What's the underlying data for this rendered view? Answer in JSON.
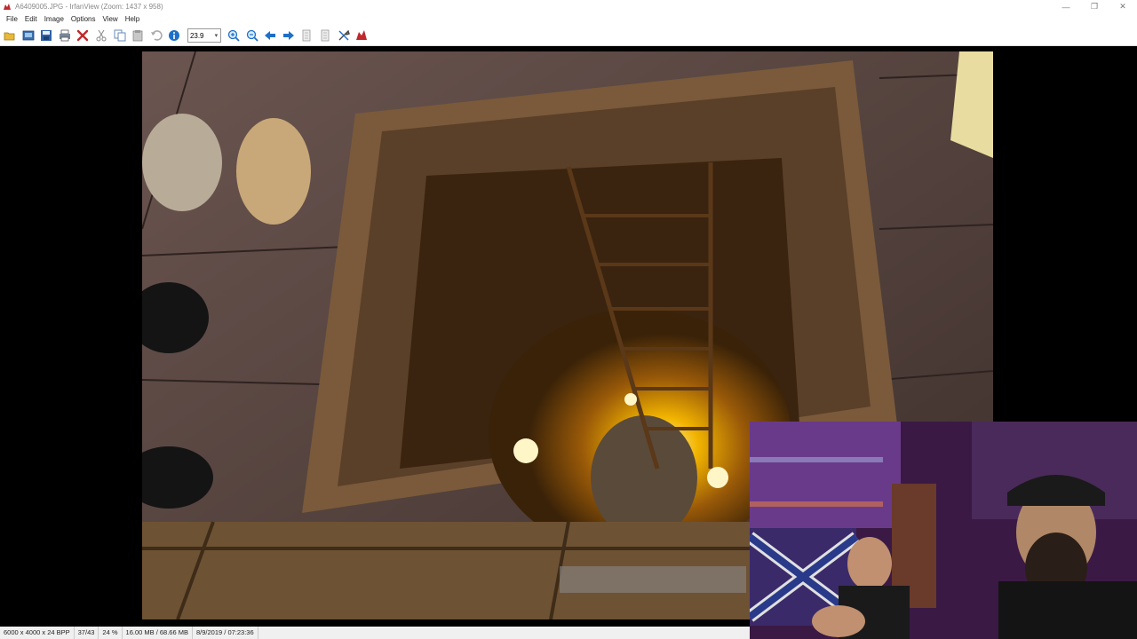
{
  "window": {
    "title": "A6409005.JPG - IrfanView (Zoom: 1437 x 958)",
    "minimize_glyph": "—",
    "maximize_glyph": "❐",
    "close_glyph": "✕"
  },
  "menu": {
    "items": [
      {
        "label": "File"
      },
      {
        "label": "Edit"
      },
      {
        "label": "Image"
      },
      {
        "label": "Options"
      },
      {
        "label": "View"
      },
      {
        "label": "Help"
      }
    ]
  },
  "toolbar": {
    "zoom_value": "23.9",
    "icons": [
      "open-folder-icon",
      "slideshow-icon",
      "save-icon",
      "print-icon",
      "delete-icon",
      "cut-icon",
      "copy-icon",
      "paste-icon",
      "undo-icon",
      "info-icon",
      "zoom-in-icon",
      "zoom-out-icon",
      "previous-icon",
      "next-icon",
      "first-page-icon",
      "last-page-icon",
      "properties-icon",
      "irfanview-logo-icon"
    ]
  },
  "status": {
    "dimensions": "6000 x 4000 x 24 BPP",
    "position": "37/43",
    "zoom_percent": "24 %",
    "memory": "16.00 MB / 68.66 MB",
    "datetime": "8/9/2019 / 07:23:36"
  },
  "colors": {
    "accent_red": "#c0282d",
    "toolbar_blue": "#1e6fc8",
    "well_glow": "#f2b400"
  }
}
